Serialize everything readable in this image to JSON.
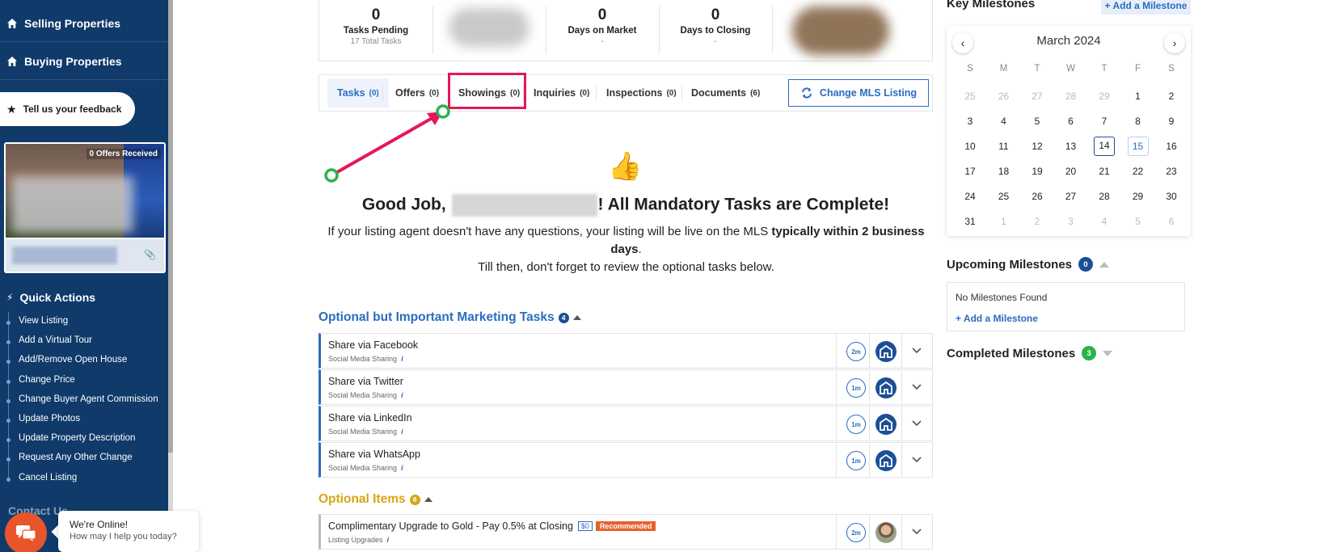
{
  "sidebar": {
    "nav": [
      {
        "label": "Selling Properties",
        "icon": "home-icon"
      },
      {
        "label": "Buying Properties",
        "icon": "home-icon"
      }
    ],
    "feedback_label": "Tell us your feedback",
    "property_card": {
      "offers_badge": "0 Offers Received"
    },
    "quick_actions": {
      "title": "Quick Actions",
      "items": [
        "View Listing",
        "Add a Virtual Tour",
        "Add/Remove Open House",
        "Change Price",
        "Change Buyer Agent Commission",
        "Update Photos",
        "Update Property Description",
        "Request Any Other Change",
        "Cancel Listing"
      ]
    },
    "contact_title": "Contact Us"
  },
  "chat": {
    "line1": "We're Online!",
    "line2": "How may I help you today?"
  },
  "stats": [
    {
      "num": "0",
      "label": "Tasks Pending",
      "sub": "17 Total Tasks"
    },
    {
      "num": "0",
      "label": "Days on Market",
      "sub": "-"
    },
    {
      "num": "0",
      "label": "Days to Closing",
      "sub": "-"
    }
  ],
  "tabs": [
    {
      "label": "Tasks",
      "count": "(0)"
    },
    {
      "label": "Offers",
      "count": "(0)"
    },
    {
      "label": "Showings",
      "count": "(0)"
    },
    {
      "label": "Inquiries",
      "count": "(0)"
    },
    {
      "label": "Inspections",
      "count": "(0)"
    },
    {
      "label": "Documents",
      "count": "(6)"
    }
  ],
  "mls_button": "Change MLS Listing",
  "good_job": {
    "prefix": "Good Job, ",
    "suffix": "! All Mandatory Tasks are Complete!",
    "text_a": "If your listing agent doesn't have any questions, your listing will be live on the MLS ",
    "text_bold": "typically within 2 business days",
    "text_b": ".",
    "text_c": "Till then, don't forget to review the optional tasks below."
  },
  "marketing": {
    "title": "Optional but Important Marketing Tasks",
    "count": "4",
    "tasks": [
      {
        "title": "Share via Facebook",
        "sub": "Social Media Sharing",
        "time": "2m"
      },
      {
        "title": "Share via Twitter",
        "sub": "Social Media Sharing",
        "time": "1m"
      },
      {
        "title": "Share via LinkedIn",
        "sub": "Social Media Sharing",
        "time": "1m"
      },
      {
        "title": "Share via WhatsApp",
        "sub": "Social Media Sharing",
        "time": "1m"
      }
    ]
  },
  "optional_items": {
    "title": "Optional Items",
    "count": "8",
    "tasks": [
      {
        "title": "Complimentary Upgrade to Gold - Pay 0.5% at Closing",
        "price": "$0",
        "tag": "Recommended",
        "sub": "Listing Upgrades",
        "time": "2m"
      }
    ]
  },
  "key_milestones": {
    "title": "Key Milestones",
    "add_label": "+ Add a Milestone"
  },
  "calendar": {
    "title": "March 2024",
    "weekdays": [
      "S",
      "M",
      "T",
      "W",
      "T",
      "F",
      "S"
    ],
    "weeks": [
      [
        "25",
        "26",
        "27",
        "28",
        "29",
        "1",
        "2"
      ],
      [
        "3",
        "4",
        "5",
        "6",
        "7",
        "8",
        "9"
      ],
      [
        "10",
        "11",
        "12",
        "13",
        "14",
        "15",
        "16"
      ],
      [
        "17",
        "18",
        "19",
        "20",
        "21",
        "22",
        "23"
      ],
      [
        "24",
        "25",
        "26",
        "27",
        "28",
        "29",
        "30"
      ],
      [
        "31",
        "1",
        "2",
        "3",
        "4",
        "5",
        "6"
      ]
    ],
    "today": "14",
    "selected": "15"
  },
  "upcoming": {
    "title": "Upcoming Milestones",
    "count": "0",
    "empty": "No Milestones Found",
    "add_label": "+ Add a Milestone"
  },
  "completed": {
    "title": "Completed Milestones",
    "count": "3"
  },
  "colors": {
    "sidebar": "#0f3a6a",
    "accent": "#2b6cbf",
    "highlight": "#e5175a",
    "marketing_title": "#2b6cbf",
    "optional_title": "#d6a516",
    "green_badge": "#2bb24c"
  }
}
